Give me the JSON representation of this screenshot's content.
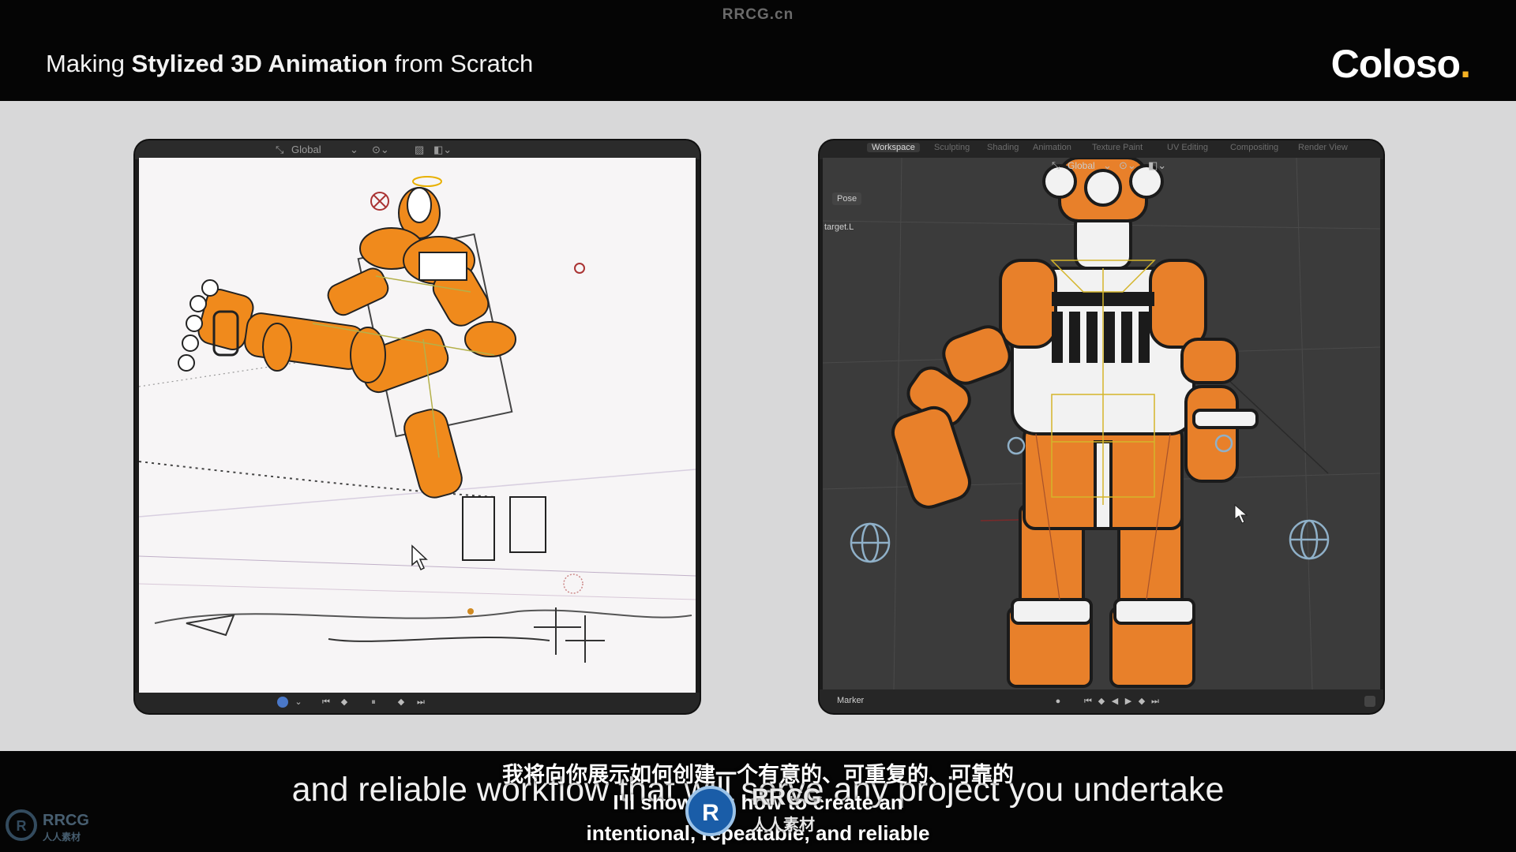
{
  "watermark": "RRCG.cn",
  "header": {
    "title_prefix": "Making ",
    "title_bold": "Stylized 3D Animation",
    "title_suffix": " from Scratch",
    "logo_text": "Coloso",
    "logo_dot": "."
  },
  "left_panel": {
    "transform_orientation": "Global"
  },
  "right_panel": {
    "workspace_tabs": [
      "Workspace",
      "Sculpting",
      "Shading",
      "Animation",
      "Texture Paint",
      "UV Editing",
      "Compositing",
      "Render View"
    ],
    "active_tab": "Workspace",
    "transform_orientation": "Global",
    "mode_label": "Pose",
    "bone_label": "target.L",
    "marker_label": "Marker"
  },
  "subtitles": {
    "main": "and reliable workflow that will serve any project you undertake",
    "chinese": "我将向你展示如何创建一个有意的、可重复的、可靠的",
    "english_line1": "I'll show you how to create an",
    "english_line2": "intentional, repeatable, and reliable"
  },
  "corner_logo": {
    "line1": "RRCG",
    "line2": "人人素材"
  },
  "center_logo": {
    "line1": "RRCG",
    "line2": "人人素材"
  },
  "colors": {
    "accent_orange": "#f08a1c",
    "logo_dot": "#f6b223"
  }
}
